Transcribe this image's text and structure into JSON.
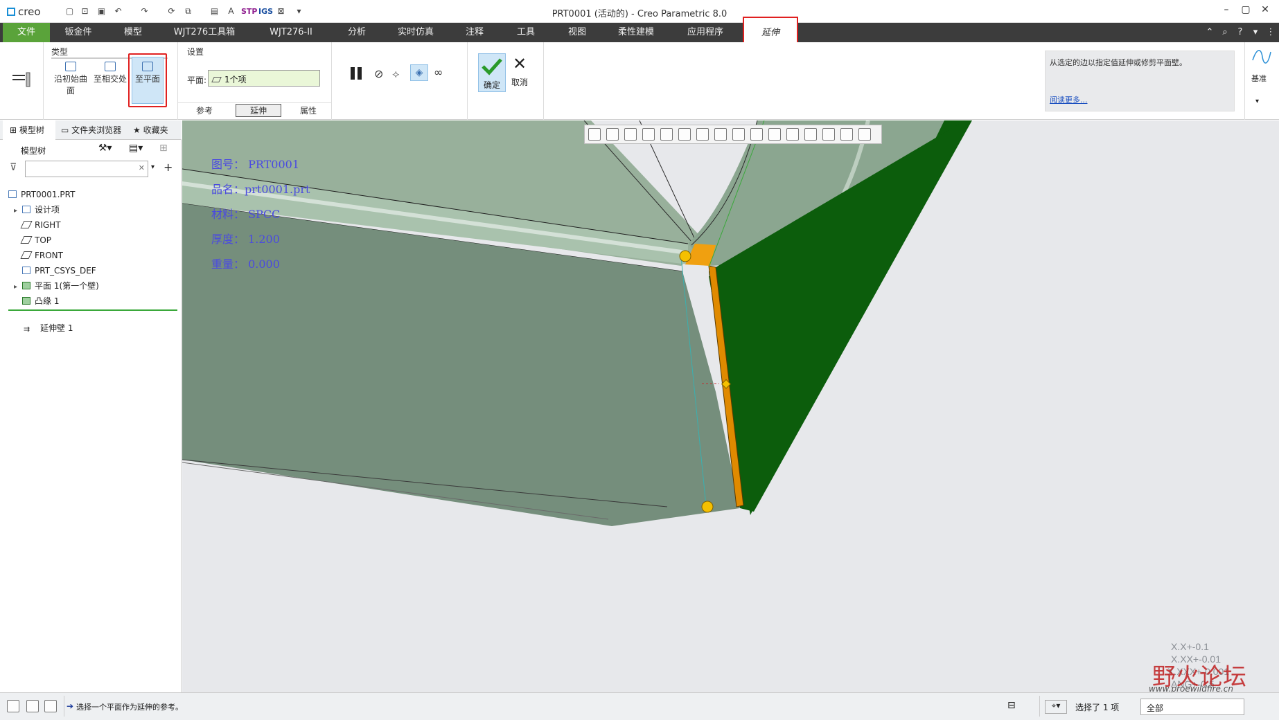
{
  "app": {
    "logo": "creo",
    "window_title": "PRT0001 (活动的) - Creo Parametric 8.0"
  },
  "menubar": {
    "file": "文件",
    "items": [
      "钣金件",
      "模型",
      "WJT276工具箱",
      "WJT276-II",
      "分析",
      "实时仿真",
      "注释",
      "工具",
      "视图",
      "柔性建模",
      "应用程序"
    ],
    "active": "延伸"
  },
  "ribbon": {
    "type_group": "类型",
    "type_buttons": [
      "沿初始曲面",
      "至相交处",
      "至平面"
    ],
    "settings_group": "设置",
    "plane_label": "平面:",
    "plane_value": "1个项",
    "subtabs": [
      "参考",
      "延伸",
      "属性"
    ],
    "ok_label": "确定",
    "cancel_label": "取消",
    "help_text": "从选定的边以指定值延伸或修剪平面壁。",
    "help_link": "阅读更多...",
    "datum_label": "基准"
  },
  "left_panel": {
    "tabs": [
      "模型树",
      "文件夹浏览器",
      "收藏夹"
    ],
    "tree_header": "模型树",
    "tree_items": [
      {
        "label": "PRT0001.PRT",
        "indent": 0,
        "expand": false
      },
      {
        "label": "设计项",
        "indent": 1,
        "expand": true
      },
      {
        "label": "RIGHT",
        "indent": 1,
        "expand": false
      },
      {
        "label": "TOP",
        "indent": 1,
        "expand": false
      },
      {
        "label": "FRONT",
        "indent": 1,
        "expand": false
      },
      {
        "label": "PRT_CSYS_DEF",
        "indent": 1,
        "expand": false
      },
      {
        "label": "平面 1(第一个壁)",
        "indent": 1,
        "expand": true
      },
      {
        "label": "凸缘 1",
        "indent": 1,
        "expand": false
      }
    ],
    "insert_item": "延伸壁 1"
  },
  "viewport": {
    "info_lines": [
      "图号： PRT0001",
      "品名：prt0001.prt",
      "材料： SPCC",
      "厚度： 1.200",
      "重量： 0.000"
    ],
    "tolerances": [
      "X.X+-0.1",
      "X.XX+-0.01",
      "X.XXX+-0.001",
      "ANG+-0.5"
    ],
    "watermark_cn": "野火论坛",
    "watermark_url": "www.proewildfire.cn"
  },
  "statusbar": {
    "message": "选择一个平面作为延伸的参考。",
    "selection": "选择了 1 项",
    "filter": "全部"
  },
  "colors": {
    "menubar_bg": "#3c3c3c",
    "file_tab": "#5aa33a",
    "highlight_red": "#e02020",
    "part_face": "#7c9a84",
    "green_face": "#0c5d0c",
    "extend_orange": "#e08a00"
  }
}
